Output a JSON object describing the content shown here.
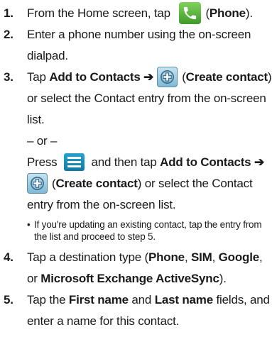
{
  "steps": [
    {
      "num": "1.",
      "a": "From the Home screen, tap ",
      "b": "(",
      "c": "Phone",
      "d": ")."
    },
    {
      "num": "2.",
      "text": "Enter a phone number using the on-screen dialpad."
    },
    {
      "num": "3.",
      "a": "Tap ",
      "b": "Add to Contacts ➔",
      "c": "(",
      "d": "Create contact",
      "e": ")",
      "f": " or select the Contact entry from the on-screen list."
    },
    {
      "num": "4.",
      "a": "Tap a destination type (",
      "b": "Phone",
      "c": ", ",
      "d": "SIM",
      "e": ", ",
      "f": "Google",
      "g": ", or ",
      "h": "Microsoft Exchange ActiveSync",
      "i": ")."
    },
    {
      "num": "5.",
      "a": "Tap the ",
      "b": "First name",
      "c": " and ",
      "d": "Last name",
      "e": " fields, and enter a name for this contact."
    }
  ],
  "or_text": "– or –",
  "alt": {
    "a": "Press ",
    "b": " and then tap ",
    "c": "Add to Contacts ➔",
    "d": "(",
    "e": "Create contact",
    "f": ") or select the Contact entry from the on-screen list."
  },
  "note": {
    "bullet": "•",
    "text": "If you're updating an existing contact, tap the entry from the list and proceed to step 5."
  },
  "icons": {
    "phone": "phone-icon",
    "add": "create-contact-icon",
    "menu": "menu-icon"
  },
  "colors": {
    "phone_green": "#4caf34",
    "plus_blue": "#9fcbe3",
    "menu_blue": "#1890bb"
  }
}
